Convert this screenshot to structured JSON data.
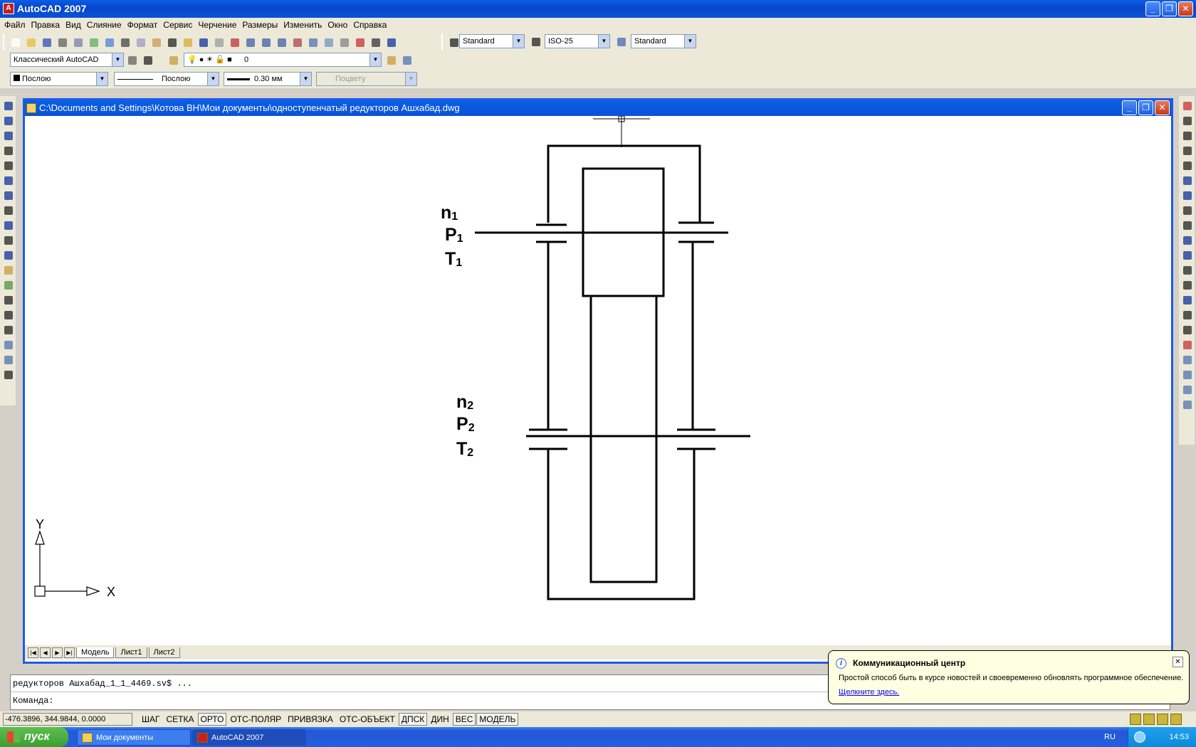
{
  "app": {
    "title": "AutoCAD 2007",
    "icon": "autocad-logo-icon"
  },
  "menu": [
    "Файл",
    "Правка",
    "Вид",
    "Слияние",
    "Формат",
    "Сервис",
    "Черчение",
    "Размеры",
    "Изменить",
    "Окно",
    "Справка"
  ],
  "toolbar": {
    "text_style": "Standard",
    "dim_style": "ISO-25",
    "table_style": "Standard",
    "workspace": "Классический AutoCAD",
    "layer": "0",
    "color": "Послою",
    "linetype": "Послою",
    "lineweight": "0.30 мм",
    "plotstyle": "Поцвету"
  },
  "drawing_window": {
    "title": "C:\\Documents and Settings\\Котова ВН\\Мои документы\\одноступенчатый редукторов Ашхабад.dwg",
    "labels": {
      "n1": "n",
      "n1_sub": "1",
      "p1": "P",
      "p1_sub": "1",
      "t1": "T",
      "t1_sub": "1",
      "n2": "n",
      "n2_sub": "2",
      "p2": "P",
      "p2_sub": "2",
      "t2": "T",
      "t2_sub": "2"
    },
    "ucs": {
      "x": "X",
      "y": "Y"
    },
    "tabs": [
      "Модель",
      "Лист1",
      "Лист2"
    ],
    "active_tab": "Модель"
  },
  "command_line": {
    "history": "редукторов Ашхабад_1_1_4469.sv$ ...",
    "prompt": "Команда:"
  },
  "status": {
    "coords": "-476.3896, 344.9844, 0.0000",
    "buttons": [
      {
        "label": "ШАГ",
        "on": false
      },
      {
        "label": "СЕТКА",
        "on": false
      },
      {
        "label": "ОРТО",
        "on": true
      },
      {
        "label": "ОТС-ПОЛЯР",
        "on": false
      },
      {
        "label": "ПРИВЯЗКА",
        "on": false
      },
      {
        "label": "ОТС-ОБЪЕКТ",
        "on": false
      },
      {
        "label": "ДПСК",
        "on": true
      },
      {
        "label": "ДИН",
        "on": false
      },
      {
        "label": "ВЕС",
        "on": true
      },
      {
        "label": "МОДЕЛЬ",
        "on": true
      }
    ]
  },
  "notification": {
    "title": "Коммуникационный центр",
    "text": "Простой способ быть в курсе новостей и своевременно обновлять программное обеспечение.",
    "link": "Щелкните здесь."
  },
  "taskbar": {
    "start": "пуск",
    "items": [
      "Мои документы",
      "AutoCAD 2007"
    ],
    "active_item": "AutoCAD 2007",
    "lang": "RU",
    "clock": "14:53"
  }
}
